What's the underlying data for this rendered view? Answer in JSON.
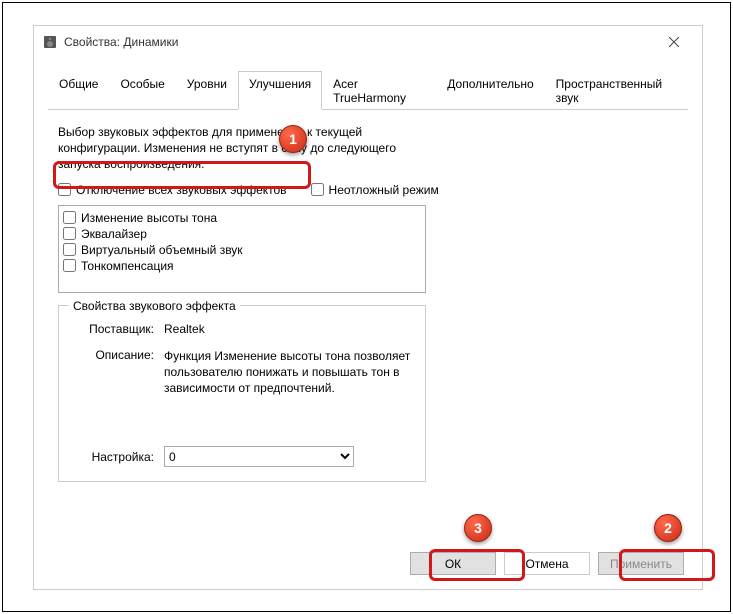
{
  "window": {
    "title": "Свойства: Динамики"
  },
  "tabs": {
    "items": [
      {
        "label": "Общие"
      },
      {
        "label": "Особые"
      },
      {
        "label": "Уровни"
      },
      {
        "label": "Улучшения"
      },
      {
        "label": "Acer TrueHarmony"
      },
      {
        "label": "Дополнительно"
      },
      {
        "label": "Пространственный звук"
      }
    ],
    "active_index": 3
  },
  "enhancements": {
    "description": "Выбор звуковых эффектов для применения к текущей конфигурации. Изменения не вступят в силу до следующего запуска воспроизведения.",
    "disable_all_label": "Отключение всех звуковых эффектов",
    "immediate_label": "Неотложный режим",
    "list": [
      {
        "label": "Изменение высоты тона"
      },
      {
        "label": "Эквалайзер"
      },
      {
        "label": "Виртуальный объемный звук"
      },
      {
        "label": "Тонкомпенсация"
      }
    ],
    "properties_legend": "Свойства звукового эффекта",
    "provider_label": "Поставщик:",
    "provider_value": "Realtek",
    "description_label": "Описание:",
    "description_value": "Функция Изменение высоты тона позволяет пользователю понижать и повышать тон в зависимости от предпочтений.",
    "setting_label": "Настройка:",
    "setting_value": "0"
  },
  "buttons": {
    "ok": "ОК",
    "cancel": "Отмена",
    "apply": "Применить"
  },
  "annotations": {
    "b1": "1",
    "b2": "2",
    "b3": "3"
  }
}
